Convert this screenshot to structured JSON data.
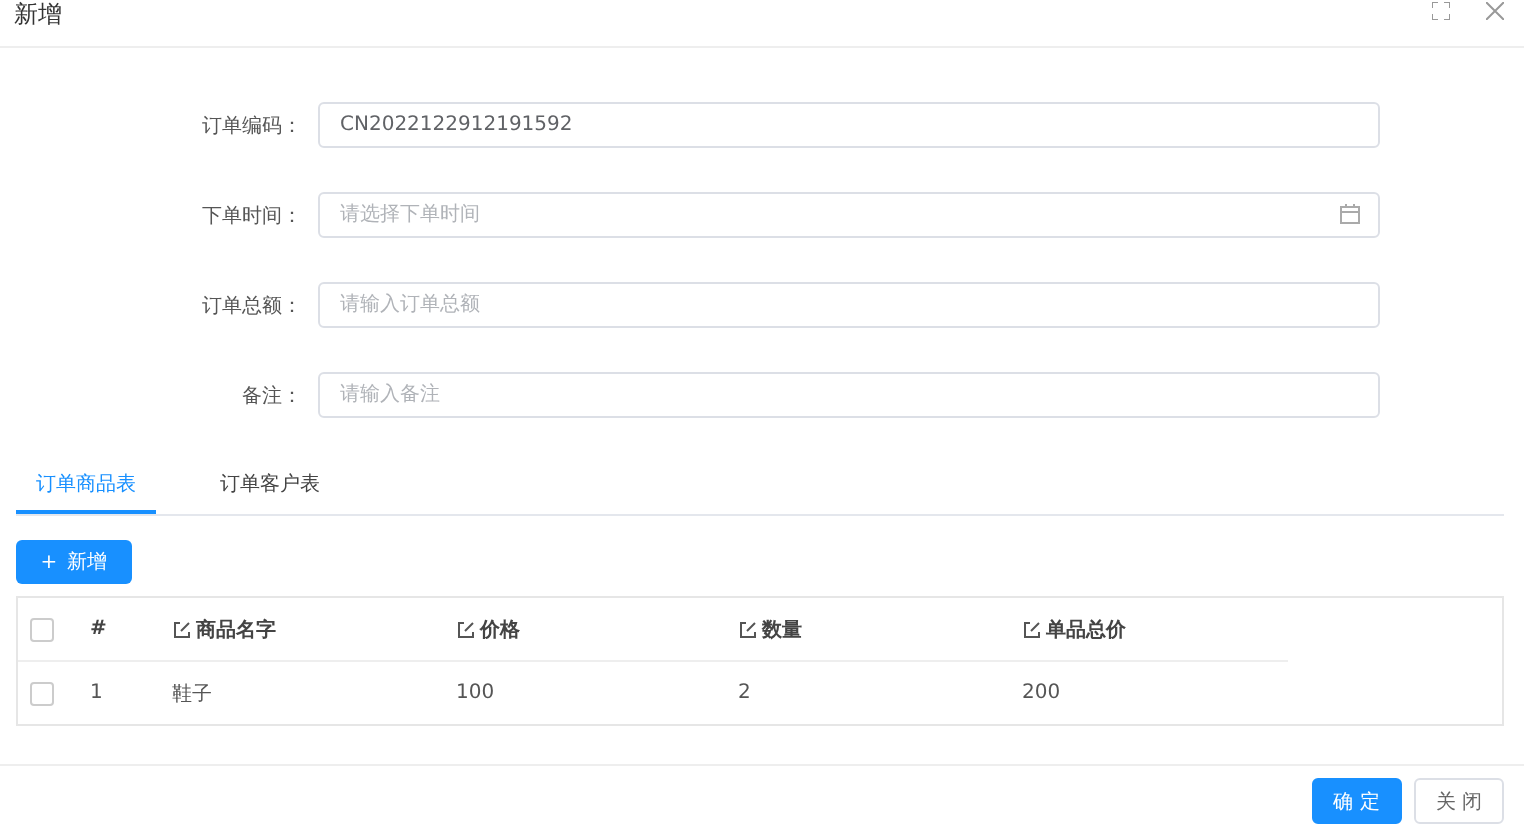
{
  "dialog": {
    "title": "新增"
  },
  "form": [
    {
      "label": "订单编码：",
      "value": "CN2022122912191592"
    },
    {
      "label": "下单时间：",
      "placeholder": "请选择下单时间",
      "kind": "date"
    },
    {
      "label": "订单总额：",
      "placeholder": "请输入订单总额"
    },
    {
      "label": "备注：",
      "placeholder": "请输入备注"
    }
  ],
  "tabs": [
    {
      "label": "订单商品表",
      "selected": true
    },
    {
      "label": "订单客户表",
      "selected": false
    }
  ],
  "add_button": {
    "icon": "+",
    "label": "新增"
  },
  "table": {
    "select_all": {
      "checked": false
    },
    "columns": [
      "#",
      "商品名字",
      "价格",
      "数量",
      "单品总价"
    ],
    "rows": [
      {
        "checked": false,
        "cells": [
          "1",
          "鞋子",
          "100",
          "2",
          "200"
        ]
      }
    ]
  },
  "footer": {
    "buttons": [
      {
        "label": "确 定",
        "kind": "primary"
      },
      {
        "label": "关 闭",
        "kind": "default"
      }
    ]
  }
}
